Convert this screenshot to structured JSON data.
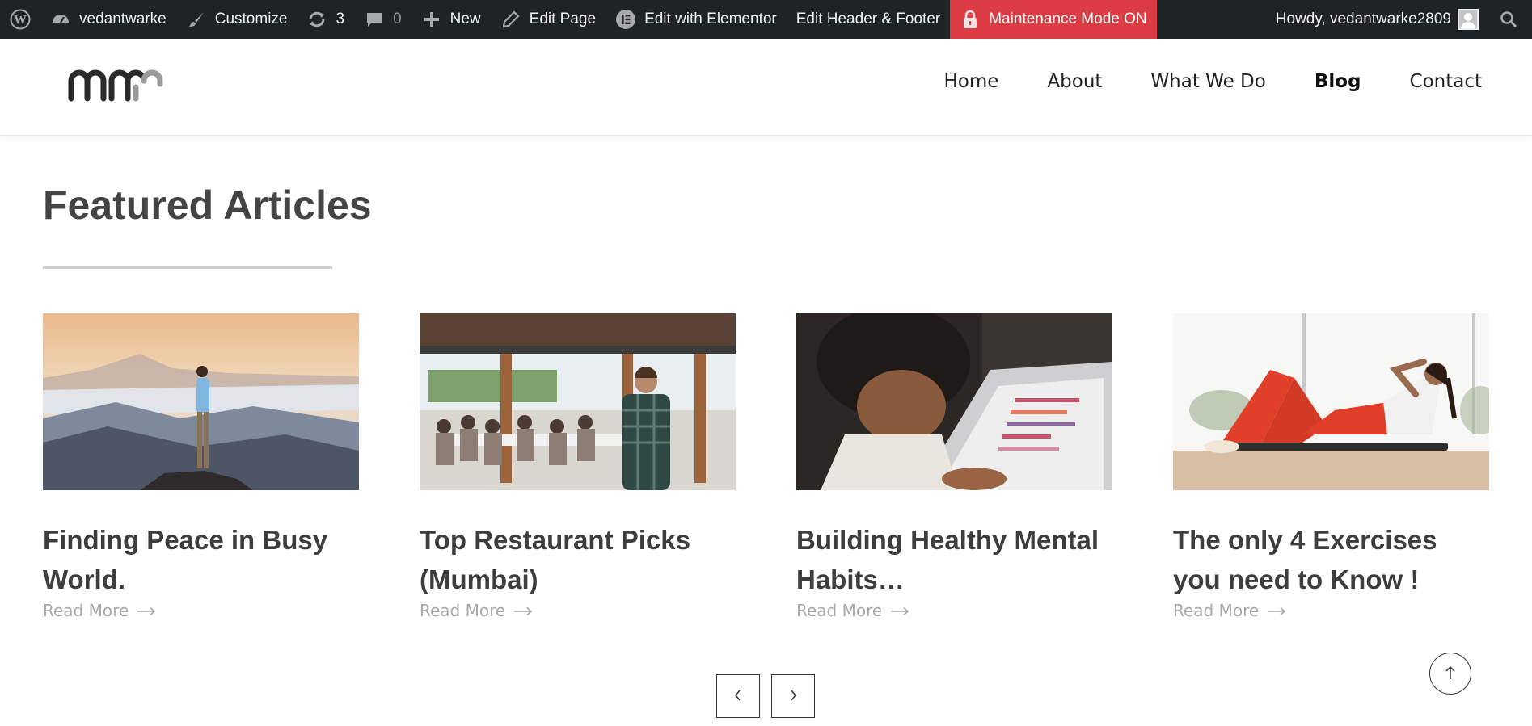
{
  "adminbar": {
    "site_name": "vedantwarke",
    "customize": "Customize",
    "updates_count": "3",
    "comments_count": "0",
    "new_label": "New",
    "edit_page": "Edit Page",
    "edit_elementor": "Edit with Elementor",
    "edit_header_footer": "Edit Header & Footer",
    "maintenance": "Maintenance Mode ON",
    "howdy": "Howdy, vedantwarke2809"
  },
  "nav": {
    "items": [
      "Home",
      "About",
      "What We Do",
      "Blog",
      "Contact"
    ],
    "active": "Blog"
  },
  "main": {
    "title": "Featured Articles",
    "cards": [
      {
        "title": "Finding Peace in Busy World.",
        "read_more": "Read More",
        "image": "mountain-sunrise"
      },
      {
        "title": "Top Restaurant Picks (Mumbai)",
        "read_more": "Read More",
        "image": "restaurant-gathering"
      },
      {
        "title": "Building Healthy Mental Habits…",
        "read_more": "Read More",
        "image": "woman-laptop"
      },
      {
        "title": "The only 4 Exercises you need to Know !",
        "read_more": "Read More",
        "image": "woman-crunches"
      }
    ]
  },
  "colors": {
    "adminbar_bg": "#1d2327",
    "maintenance_bg": "#dc3d45",
    "heading": "#444444",
    "read_more": "#a8a8a8"
  }
}
